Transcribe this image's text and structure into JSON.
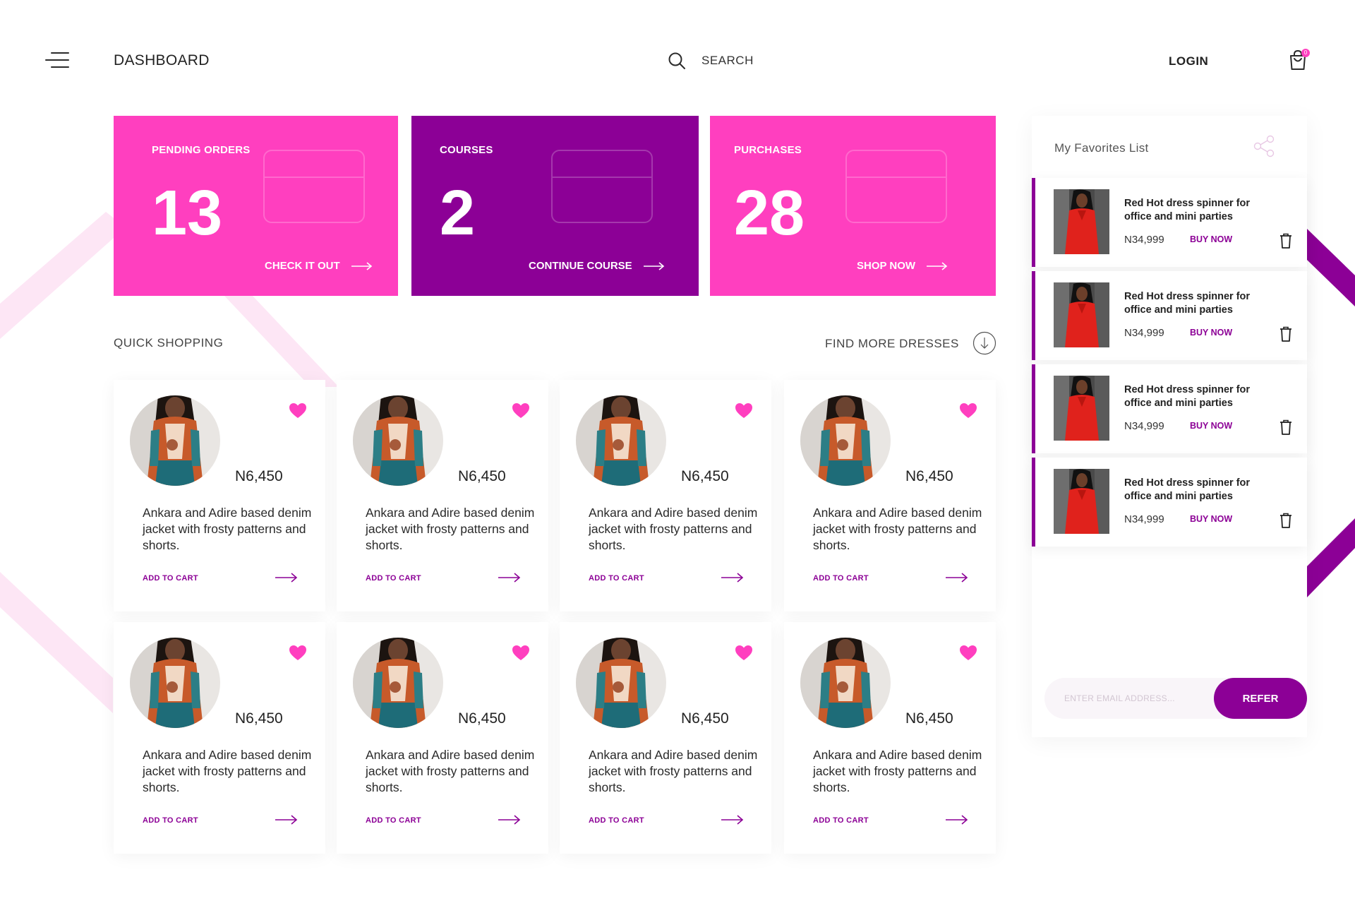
{
  "header": {
    "title": "DASHBOARD",
    "search_label": "SEARCH",
    "login_label": "LOGIN",
    "cart_count": "0"
  },
  "stats": [
    {
      "label": "PENDING ORDERS",
      "value": "13",
      "cta": "CHECK IT OUT",
      "color": "#ff3fbf"
    },
    {
      "label": "COURSES",
      "value": "2",
      "cta": "CONTINUE COURSE",
      "color": "#8c0096"
    },
    {
      "label": "PURCHASES",
      "value": "28",
      "cta": "SHOP NOW",
      "color": "#ff3fbf"
    }
  ],
  "quick_shopping": {
    "title": "QUICK SHOPPING",
    "find_more": "FIND MORE DRESSES",
    "products": [
      {
        "price": "N6,450",
        "description": "Ankara and Adire based denim jacket with frosty patterns and shorts.",
        "cta": "ADD TO CART"
      },
      {
        "price": "N6,450",
        "description": "Ankara and Adire based denim jacket with frosty patterns and shorts.",
        "cta": "ADD TO CART"
      },
      {
        "price": "N6,450",
        "description": "Ankara and Adire based denim jacket with frosty patterns and shorts.",
        "cta": "ADD TO CART"
      },
      {
        "price": "N6,450",
        "description": "Ankara and Adire based denim jacket with frosty patterns and shorts.",
        "cta": "ADD TO CART"
      },
      {
        "price": "N6,450",
        "description": "Ankara and Adire based denim jacket with frosty patterns and shorts.",
        "cta": "ADD TO CART"
      },
      {
        "price": "N6,450",
        "description": "Ankara and Adire based denim jacket with frosty patterns and shorts.",
        "cta": "ADD TO CART"
      },
      {
        "price": "N6,450",
        "description": "Ankara and Adire based denim jacket with frosty patterns and shorts.",
        "cta": "ADD TO CART"
      },
      {
        "price": "N6,450",
        "description": "Ankara and Adire based denim jacket with frosty patterns and shorts.",
        "cta": "ADD TO CART"
      }
    ]
  },
  "favorites": {
    "title": "My Favorites List",
    "items": [
      {
        "name": "Red Hot dress spinner for office and mini parties",
        "price": "N34,999",
        "cta": "BUY NOW"
      },
      {
        "name": "Red Hot dress spinner for office and mini parties",
        "price": "N34,999",
        "cta": "BUY NOW"
      },
      {
        "name": "Red Hot dress spinner for office and mini parties",
        "price": "N34,999",
        "cta": "BUY NOW"
      },
      {
        "name": "Red Hot dress spinner for office and mini parties",
        "price": "N34,999",
        "cta": "BUY NOW"
      }
    ],
    "refer_placeholder": "ENTER EMAIL ADDRESS...",
    "refer_button": "REFER"
  },
  "colors": {
    "pink": "#ff3fbf",
    "purple": "#8c0096",
    "heart": "#ff3fbf"
  },
  "icons": [
    "menu-icon",
    "search-icon",
    "cart-icon",
    "arrow-right-icon",
    "arrow-down-circle-icon",
    "heart-icon",
    "share-icon",
    "trash-icon"
  ]
}
